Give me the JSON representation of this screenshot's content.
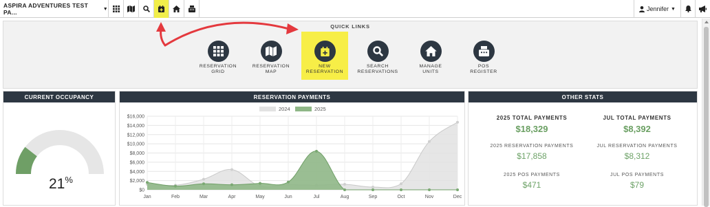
{
  "topnav": {
    "property_name": "ASPIRA ADVENTURES TEST PA...",
    "icons": [
      "grid-icon",
      "map-icon",
      "search-icon",
      "calendar-plus-icon",
      "home-icon",
      "register-icon"
    ],
    "user_name": "Jennifer",
    "active_icon": "calendar-plus-icon",
    "active_color": "#f1ee4a"
  },
  "quick_links": {
    "title": "QUICK LINKS",
    "items": [
      {
        "label": "RESERVATION\nGRID",
        "icon": "grid-icon"
      },
      {
        "label": "RESERVATION\nMAP",
        "icon": "map-icon"
      },
      {
        "label": "NEW\nRESERVATION",
        "icon": "calendar-plus-icon",
        "active": true
      },
      {
        "label": "SEARCH\nRESERVATIONS",
        "icon": "search-icon"
      },
      {
        "label": "MANAGE\nUNITS",
        "icon": "home-icon"
      },
      {
        "label": "POS\nREGISTER",
        "icon": "register-icon"
      }
    ],
    "highlight_color": "#f7ee47"
  },
  "occupancy": {
    "title": "CURRENT OCCUPANCY",
    "value": "21",
    "unit": "%",
    "fraction": 0.21,
    "fill_color": "#6f9f66",
    "track_color": "#e6e6e6"
  },
  "payments": {
    "title": "RESERVATION PAYMENTS"
  },
  "chart_data": {
    "type": "area",
    "categories": [
      "Jan",
      "Feb",
      "Mar",
      "Apr",
      "May",
      "Jun",
      "Jul",
      "Aug",
      "Sep",
      "Oct",
      "Nov",
      "Dec"
    ],
    "series": [
      {
        "name": "2024",
        "color": "#e2e2e2",
        "values": [
          1200,
          1000,
          2300,
          4400,
          800,
          1100,
          1000,
          1200,
          600,
          1300,
          10500,
          14700
        ]
      },
      {
        "name": "2025",
        "color": "#8fb787",
        "values": [
          1600,
          800,
          1300,
          1100,
          1400,
          1700,
          8400,
          0,
          0,
          0,
          0,
          0
        ]
      }
    ],
    "ylim": [
      0,
      16000
    ],
    "yticks": [
      "$0",
      "$2,000",
      "$4,000",
      "$6,000",
      "$8,000",
      "$10,000",
      "$12,000",
      "$14,000",
      "$16,000"
    ],
    "grid": true,
    "legend": "top-center"
  },
  "stats": {
    "title": "OTHER STATS",
    "items": [
      {
        "label": "2025 TOTAL PAYMENTS",
        "value": "$18,329",
        "big": true
      },
      {
        "label": "JUL TOTAL PAYMENTS",
        "value": "$8,392",
        "big": true
      },
      {
        "label": "2025 RESERVATION PAYMENTS",
        "value": "$17,858"
      },
      {
        "label": "JUL RESERVATION PAYMENTS",
        "value": "$8,312"
      },
      {
        "label": "2025 POS PAYMENTS",
        "value": "$471"
      },
      {
        "label": "JUL POS PAYMENTS",
        "value": "$79"
      }
    ]
  }
}
